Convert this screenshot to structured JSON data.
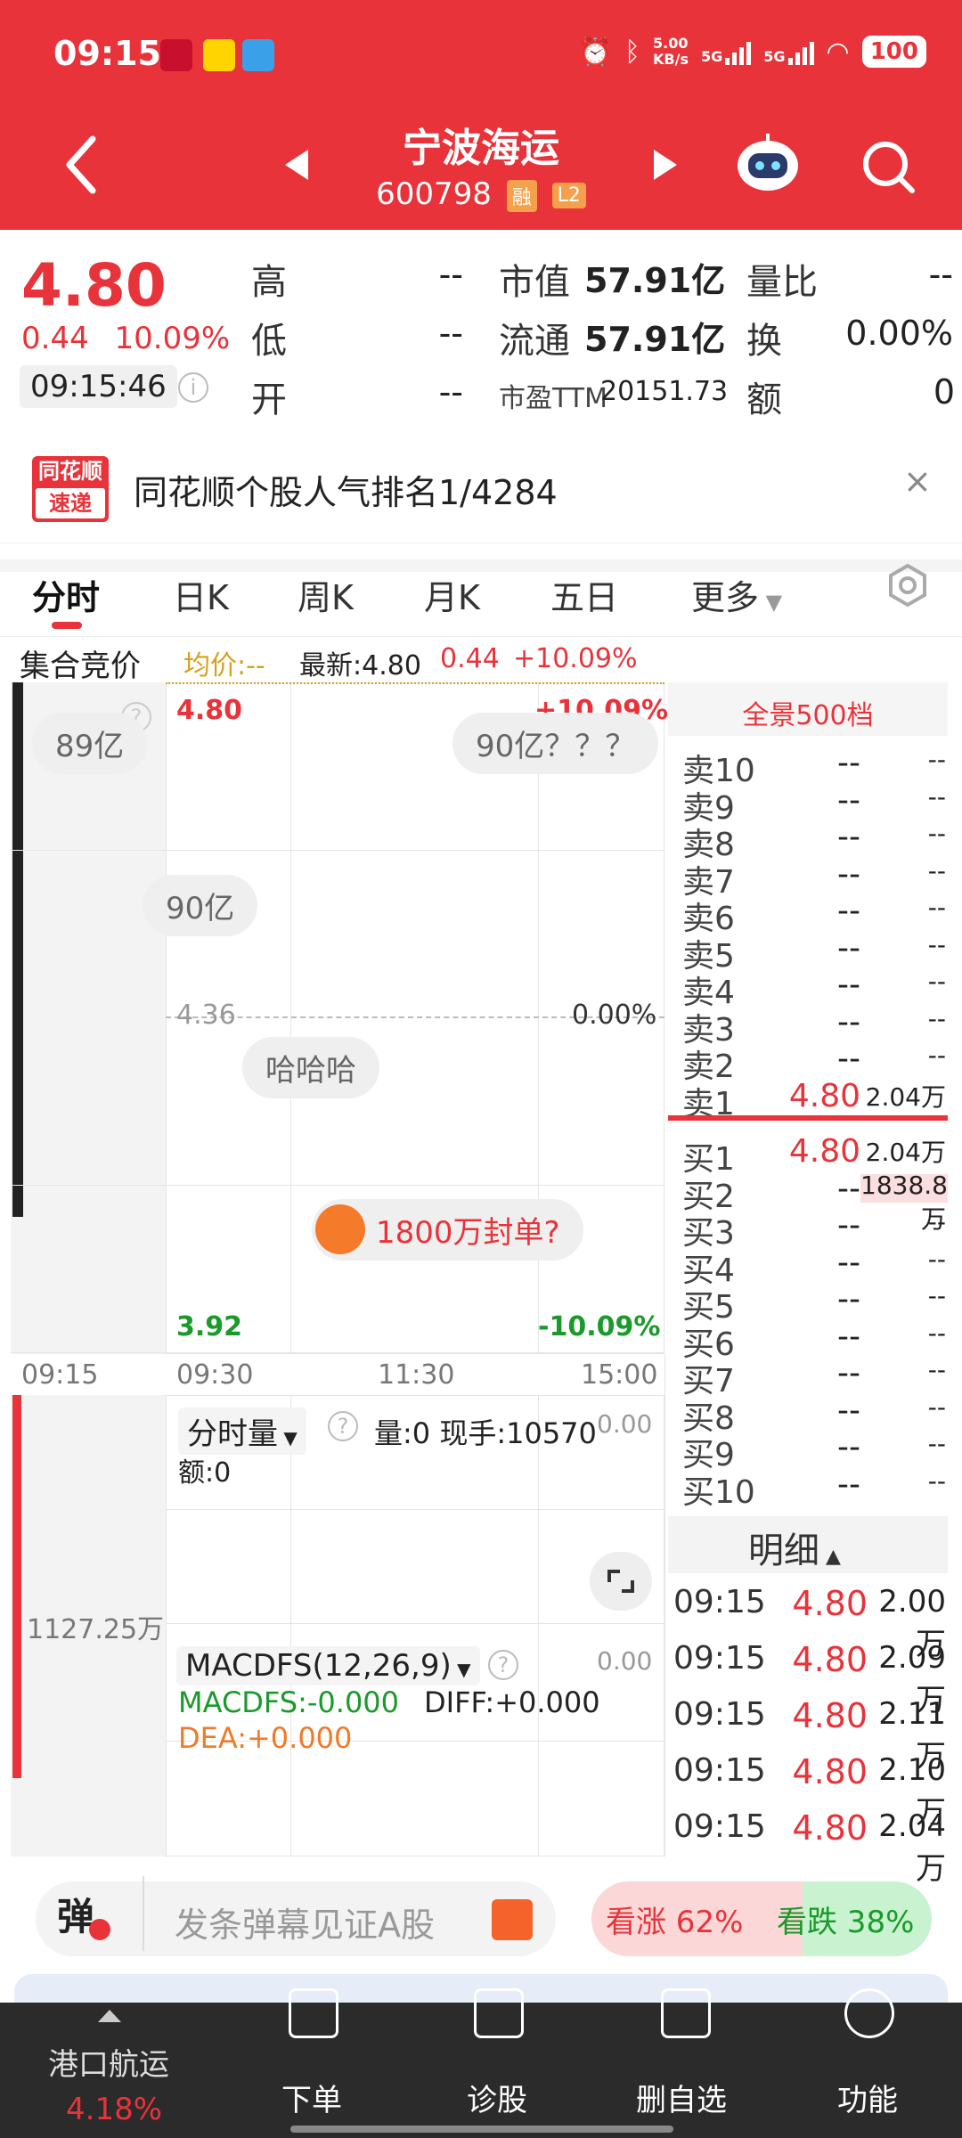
{
  "status_bar": {
    "time": "09:15",
    "net_speed": "5.00\nKB/s",
    "net_speed_top": "5.00",
    "net_speed_bottom": "KB/s",
    "sig1": "5G",
    "sig2": "5G",
    "battery": "100"
  },
  "header": {
    "stock_name": "宁波海运",
    "stock_code": "600798",
    "tag_rong": "融",
    "tag_l2": "L2"
  },
  "quote": {
    "price": "4.80",
    "change_abs": "0.44",
    "change_pct": "10.09%",
    "time": "09:15:46",
    "labels": {
      "high": "高",
      "low": "低",
      "open": "开",
      "mktcap": "市值",
      "float": "流通",
      "pe": "市盈TTM",
      "volratio": "量比",
      "turnover": "换",
      "amount": "额"
    },
    "high": "--",
    "low": "--",
    "open": "--",
    "mktcap": "57.91亿",
    "float": "57.91亿",
    "pe": "20151.73",
    "volratio": "--",
    "turnover": "0.00%",
    "amount": "0"
  },
  "banner": {
    "logo_top": "同花顺",
    "logo_bottom": "速递",
    "text": "同花顺个股人气排名1/4284",
    "close": "×"
  },
  "tabs": [
    "分时",
    "日K",
    "周K",
    "月K",
    "五日",
    "更多"
  ],
  "info_row": {
    "label": "集合竞价",
    "avg_label": "均价:--",
    "latest": "最新:4.80",
    "chg": "0.44",
    "pct": "+10.09%"
  },
  "chart": {
    "top_price": "4.80",
    "top_pct": "+10.09%",
    "mid_price": "4.36",
    "mid_pct": "0.00%",
    "bottom_price": "3.92",
    "bottom_pct": "-10.09%",
    "times": [
      "09:15",
      "09:30",
      "11:30",
      "15:00"
    ],
    "bubbles": [
      "89亿",
      "90亿？？？",
      "90亿",
      "哈哈哈",
      "1800万封单?"
    ],
    "vol_selector": "分时量",
    "vol_text": "量:0  现手:10570",
    "vol_amount": "额:0",
    "vol_right": "0.00",
    "vol_left_value": "1127.25万",
    "macd_selector": "MACDFS(12,26,9)",
    "macd_right": "0.00",
    "macdfs": "MACDFS:-0.000",
    "diff": "DIFF:+0.000",
    "dea": "DEA:+0.000"
  },
  "order_book": {
    "title": "全景500档",
    "asks": [
      {
        "label": "卖10",
        "price": "--",
        "vol": "--"
      },
      {
        "label": "卖9",
        "price": "--",
        "vol": "--"
      },
      {
        "label": "卖8",
        "price": "--",
        "vol": "--"
      },
      {
        "label": "卖7",
        "price": "--",
        "vol": "--"
      },
      {
        "label": "卖6",
        "price": "--",
        "vol": "--"
      },
      {
        "label": "卖5",
        "price": "--",
        "vol": "--"
      },
      {
        "label": "卖4",
        "price": "--",
        "vol": "--"
      },
      {
        "label": "卖3",
        "price": "--",
        "vol": "--"
      },
      {
        "label": "卖2",
        "price": "--",
        "vol": "--"
      },
      {
        "label": "卖1",
        "price": "4.80",
        "vol": "2.04万"
      }
    ],
    "bids": [
      {
        "label": "买1",
        "price": "4.80",
        "vol": "2.04万"
      },
      {
        "label": "买2",
        "price": "--",
        "vol": "1838.8万"
      },
      {
        "label": "买3",
        "price": "--",
        "vol": "--"
      },
      {
        "label": "买4",
        "price": "--",
        "vol": "--"
      },
      {
        "label": "买5",
        "price": "--",
        "vol": "--"
      },
      {
        "label": "买6",
        "price": "--",
        "vol": "--"
      },
      {
        "label": "买7",
        "price": "--",
        "vol": "--"
      },
      {
        "label": "买8",
        "price": "--",
        "vol": "--"
      },
      {
        "label": "买9",
        "price": "--",
        "vol": "--"
      },
      {
        "label": "买10",
        "price": "--",
        "vol": "--"
      }
    ],
    "detail_title": "明细",
    "details": [
      {
        "time": "09:15",
        "price": "4.80",
        "vol": "2.00万"
      },
      {
        "time": "09:15",
        "price": "4.80",
        "vol": "2.09万"
      },
      {
        "time": "09:15",
        "price": "4.80",
        "vol": "2.11万"
      },
      {
        "time": "09:15",
        "price": "4.80",
        "vol": "2.10万"
      },
      {
        "time": "09:15",
        "price": "4.80",
        "vol": "2.04万"
      }
    ]
  },
  "danmu": {
    "icon": "弹",
    "placeholder": "发条弹幕见证A股",
    "up": "看涨 62%",
    "down": "看跌 38%",
    "up_pct": 62,
    "down_pct": 38
  },
  "bottom_nav": {
    "sector": "港口航运",
    "sector_pct": "4.18%",
    "items": [
      "下单",
      "诊股",
      "删自选",
      "功能"
    ]
  },
  "colors": {
    "brand": "#e8333a",
    "up": "#e8333a",
    "down": "#1a9a2a",
    "dark_bar": "#2b2b2b"
  }
}
